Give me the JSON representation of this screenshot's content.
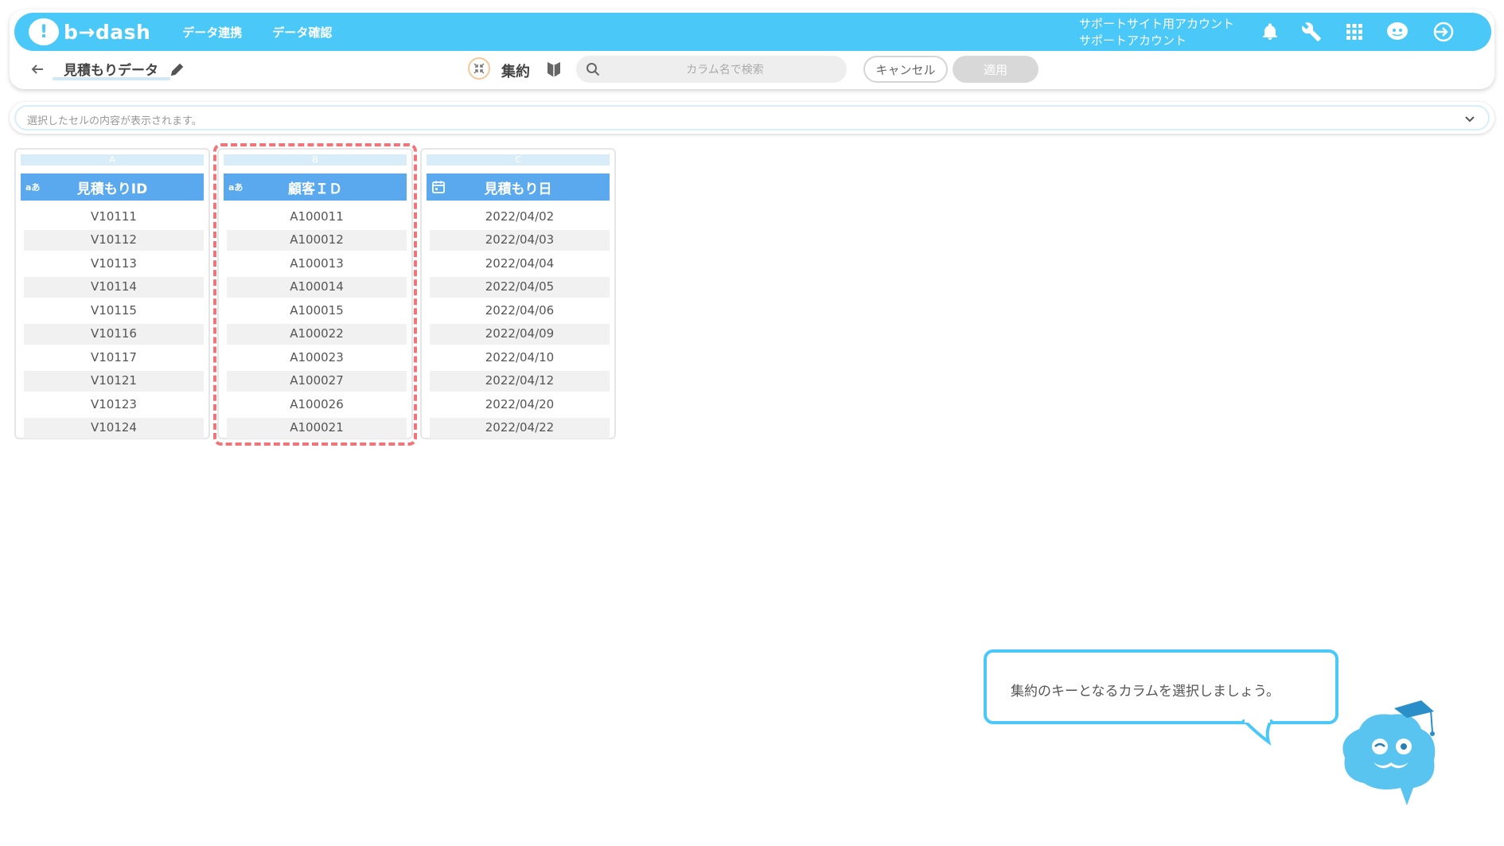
{
  "app": {
    "logo_text": "b→dash",
    "nav": [
      "データ連携",
      "データ確認"
    ],
    "account_line1": "サポートサイト用アカウント",
    "account_line2": "サポートアカウント"
  },
  "toolbar": {
    "page_title": "見積もりデータ",
    "mode_label": "集約",
    "search_placeholder": "カラム名で検索",
    "cancel_label": "キャンセル",
    "apply_label": "適用"
  },
  "cellbar": {
    "text": "選択したセルの内容が表示されます。"
  },
  "columns": [
    {
      "letter": "A",
      "type": "aあ",
      "header": "見積もりID",
      "rows": [
        "V10111",
        "V10112",
        "V10113",
        "V10114",
        "V10115",
        "V10116",
        "V10117",
        "V10121",
        "V10123",
        "V10124"
      ]
    },
    {
      "letter": "B",
      "type": "aあ",
      "header": "顧客ＩＤ",
      "rows": [
        "A100011",
        "A100012",
        "A100013",
        "A100014",
        "A100015",
        "A100022",
        "A100023",
        "A100027",
        "A100026",
        "A100021"
      ]
    },
    {
      "letter": "C",
      "type": "calendar",
      "header": "見積もり日",
      "rows": [
        "2022/04/02",
        "2022/04/03",
        "2022/04/04",
        "2022/04/05",
        "2022/04/06",
        "2022/04/09",
        "2022/04/10",
        "2022/04/12",
        "2022/04/20",
        "2022/04/22"
      ]
    }
  ],
  "guide": {
    "message": "集約のキーとなるカラムを選択しましょう。"
  },
  "colors": {
    "accent": "#4ac8f8",
    "header_blue": "#5aa8ee",
    "highlight": "#f0757a"
  }
}
